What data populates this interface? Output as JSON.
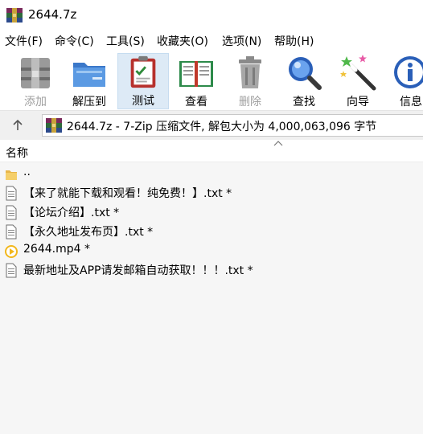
{
  "window": {
    "title": "2644.7z"
  },
  "menu": [
    "文件(F)",
    "命令(C)",
    "工具(S)",
    "收藏夹(O)",
    "选项(N)",
    "帮助(H)"
  ],
  "toolbar": [
    {
      "label": "添加",
      "icon": "add-archive-icon",
      "enabled": false
    },
    {
      "label": "解压到",
      "icon": "extract-folder-icon",
      "enabled": true
    },
    {
      "label": "测试",
      "icon": "test-clipboard-icon",
      "enabled": true,
      "pressed": true
    },
    {
      "label": "查看",
      "icon": "view-book-icon",
      "enabled": true
    },
    {
      "label": "删除",
      "icon": "trash-icon",
      "enabled": false
    },
    {
      "label": "查找",
      "icon": "magnifier-icon",
      "enabled": true
    },
    {
      "label": "向导",
      "icon": "wizard-wand-icon",
      "enabled": true
    },
    {
      "label": "信息",
      "icon": "info-icon",
      "enabled": true
    }
  ],
  "address": {
    "path": "2644.7z - 7-Zip 压缩文件, 解包大小为 4,000,063,096 字节"
  },
  "list": {
    "column_name": "名称",
    "items": [
      {
        "name": "..",
        "icon": "folder-up-icon"
      },
      {
        "name": "【来了就能下载和观看！纯免费！】.txt *",
        "icon": "text-file-icon"
      },
      {
        "name": "【论坛介绍】.txt *",
        "icon": "text-file-icon"
      },
      {
        "name": "【永久地址发布页】.txt *",
        "icon": "text-file-icon"
      },
      {
        "name": "2644.mp4 *",
        "icon": "video-file-icon"
      },
      {
        "name": "最新地址及APP请发邮箱自动获取！！！.txt *",
        "icon": "text-file-icon"
      }
    ]
  },
  "colors": {
    "accent": "#3b6fc9",
    "pressed_bg": "#ddeaf6",
    "list_bg": "#f6f6f6",
    "disabled_text": "#a0a0a0"
  }
}
